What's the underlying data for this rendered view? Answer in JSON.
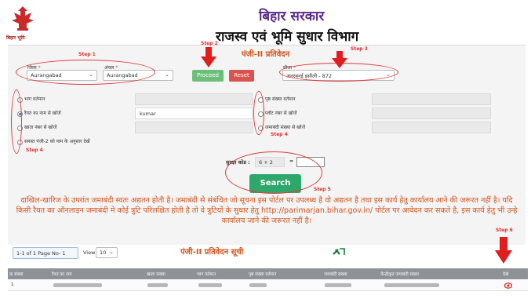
{
  "header": {
    "title": "बिहार सरकार",
    "subtitle": "राजस्व एवं भूमि सुधार विभाग",
    "logo_caption": "बिहार भूमि"
  },
  "form": {
    "title": "पंजी-II प्रतिवेदन",
    "district": {
      "label": "जिला",
      "value": "Aurangabad"
    },
    "circle": {
      "label": "अंचल",
      "value": "Aurangabad"
    },
    "mauja": {
      "label": "मौजा",
      "value": "अनरबनई इसौली - 872"
    },
    "proceed_label": "Proceed",
    "reset_label": "Reset",
    "radios_left": [
      {
        "label": "भाग वर्तमान",
        "selected": false
      },
      {
        "label": "रैयत का नाम से खोजें",
        "selected": true
      },
      {
        "label": "खाता नंबर से खोजें",
        "selected": false
      },
      {
        "label": "समस्त पंजी-2 को नाम के अनुसार देखें",
        "selected": false
      }
    ],
    "name_value": "kumar",
    "radios_right": [
      {
        "label": "पृष्ठ संख्या वर्तमान",
        "selected": false
      },
      {
        "label": "प्लॉट नंबर से खोजें",
        "selected": false
      },
      {
        "label": "जमाबंदी संख्या से खोजें",
        "selected": false
      }
    ],
    "captcha": {
      "label": "सुरक्षा कोड :",
      "question": "6 + 2",
      "equals": "=",
      "answer": ""
    },
    "search_label": "Search"
  },
  "steps": {
    "step1": "Step 1",
    "step2": "Step 2",
    "step3": "Step 3",
    "step4a": "Step 4",
    "step4b": "Step 4",
    "step5": "Step 5",
    "step6": "Step 6"
  },
  "notice": "दाखिल-खारिज के उपरांत जमाबंदी स्वतः अद्यतन होती है। जमाबंदी से संबंधित जो सूचना इस पोर्टल पर उपलब्ध है वो अद्यतन है तथा इस कार्य हेतु कार्यालय आने की जरूरत नहीं है। यदि किसी रैयत का ऑनलाइन जमाबंदी मे कोई त्रुटि परिलक्षित होती है तो वे त्रुटियों के सुधार हेतु http://parimarjan.bihar.gov.in/ पोर्टल पर आवेदन कर सकते है, इस कार्य हेतु भी उन्हे कार्यालय जाने की जरूरत नहीं है।",
  "list": {
    "pager_text": "1-1 of 1     Page No- 1",
    "view_label": "View",
    "view_value": "10",
    "title": "पंजी-II प्रतिवेदन सूची"
  },
  "table": {
    "headers": [
      "क्र संख्या",
      "रैयत का नाम",
      "खाता संख्या",
      "भाग वर्तमान",
      "पृष्ठ संख्या वर्तमान",
      "जमाबंदी संख्या",
      "केंन्द्रीकृत जमाबंदी संख्या",
      "देखे"
    ],
    "rows": [
      {
        "sno": "1"
      }
    ]
  },
  "colors": {
    "accent_orange": "#d2531b",
    "annotation_red": "#e23a3a",
    "search_green": "#2ea86a",
    "title_purple": "#5a2a8a"
  }
}
